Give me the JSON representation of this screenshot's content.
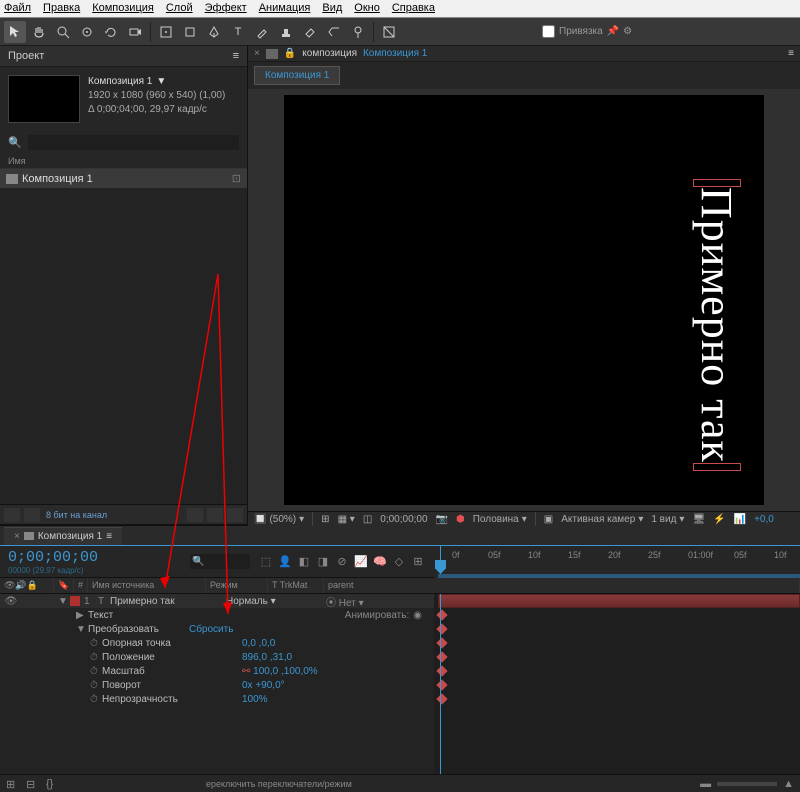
{
  "menu": [
    "Файл",
    "Правка",
    "Композиция",
    "Слой",
    "Эффект",
    "Анимация",
    "Вид",
    "Окно",
    "Справка"
  ],
  "toolbar_snap": "Привязка",
  "project": {
    "tab": "Проект",
    "compName": "Композиция 1",
    "dims": "1920 x 1080  (960 x 540) (1,00)",
    "dur": "Δ 0;00;04;00, 29,97 кадр/с",
    "nameHeader": "Имя",
    "item": "Композиция 1",
    "footer": "8 бит на канал"
  },
  "viewer": {
    "prefix": "композиция",
    "crumb": "Композиция 1",
    "tab": "Композиция 1",
    "canvasText": "Примерно так",
    "zoom": "(50%)",
    "time": "0;00;00;00",
    "quality": "Половина",
    "camera": "Активная камер",
    "views": "1 вид"
  },
  "timeline": {
    "tab": "Композиция 1",
    "timecode": "0;00;00;00",
    "sub": "00000 (29.97 кадр/с)",
    "cols": {
      "num": "#",
      "src": "Имя источника",
      "mode": "Режим",
      "trk": "T  TrkMat",
      "parent": "parent"
    },
    "ruler": [
      "0f",
      "05f",
      "10f",
      "15f",
      "20f",
      "25f",
      "01:00f",
      "05f",
      "10f"
    ],
    "layer": {
      "num": "1",
      "name": "Примерно так",
      "mode": "Нормаль",
      "parent": "Нет",
      "text": "Текст",
      "animate": "Анимировать:",
      "transform": "Преобразовать",
      "reset": "Сбросить",
      "props": [
        {
          "n": "Опорная точка",
          "v": "0,0 ,0,0"
        },
        {
          "n": "Положение",
          "v": "896,0 ,31,0"
        },
        {
          "n": "Масштаб",
          "v": "100,0 ,100,0%",
          "link": true
        },
        {
          "n": "Поворот",
          "v": "0x +90,0°"
        },
        {
          "n": "Непрозрачность",
          "v": "100%"
        }
      ]
    },
    "footer": "ереключить переключатели/режим"
  }
}
